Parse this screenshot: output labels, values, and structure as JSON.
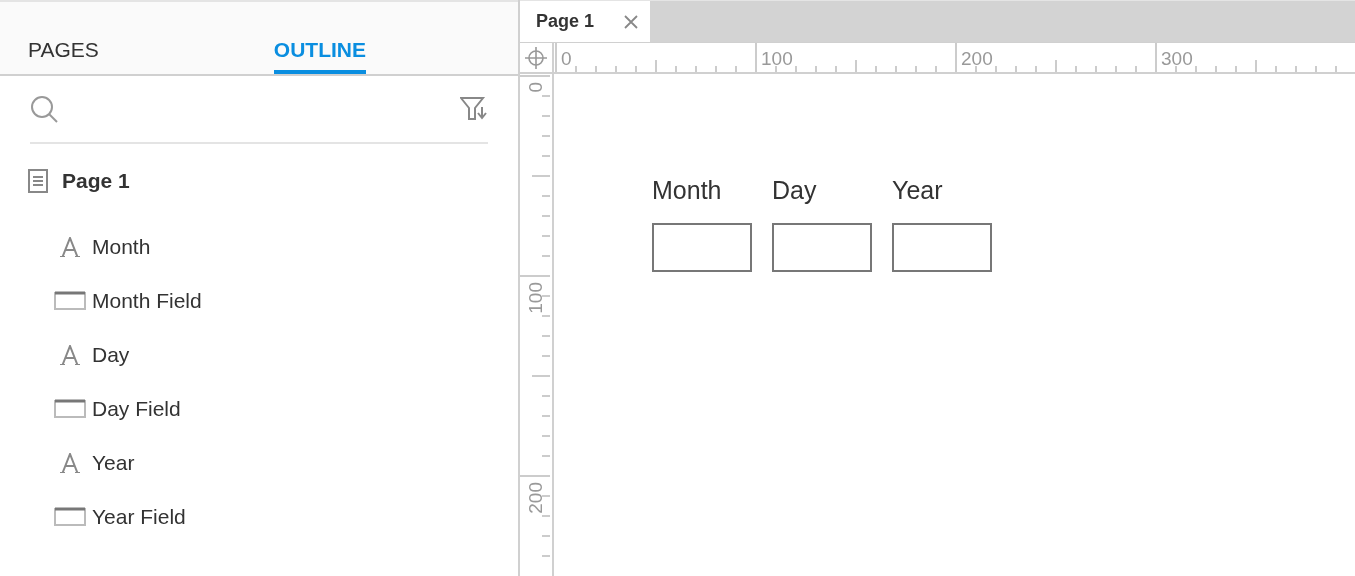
{
  "sidebar": {
    "tabs": [
      {
        "label": "PAGES",
        "selected": false
      },
      {
        "label": "OUTLINE",
        "selected": true
      }
    ],
    "outline": [
      {
        "label": "Page 1",
        "kind": "page",
        "children": [
          {
            "label": "Month",
            "kind": "text"
          },
          {
            "label": "Month Field",
            "kind": "field"
          },
          {
            "label": "Day",
            "kind": "text"
          },
          {
            "label": "Day Field",
            "kind": "field"
          },
          {
            "label": "Year",
            "kind": "text"
          },
          {
            "label": "Year Field",
            "kind": "field"
          }
        ]
      }
    ]
  },
  "editor": {
    "tabs": [
      {
        "label": "Page 1",
        "selected": true
      }
    ],
    "rulers": {
      "horizontal": [
        "0",
        "100",
        "200",
        "300"
      ],
      "vertical": [
        "0",
        "100",
        "200"
      ]
    },
    "canvas": {
      "groups": [
        {
          "label": "Month"
        },
        {
          "label": "Day"
        },
        {
          "label": "Year"
        }
      ]
    }
  }
}
